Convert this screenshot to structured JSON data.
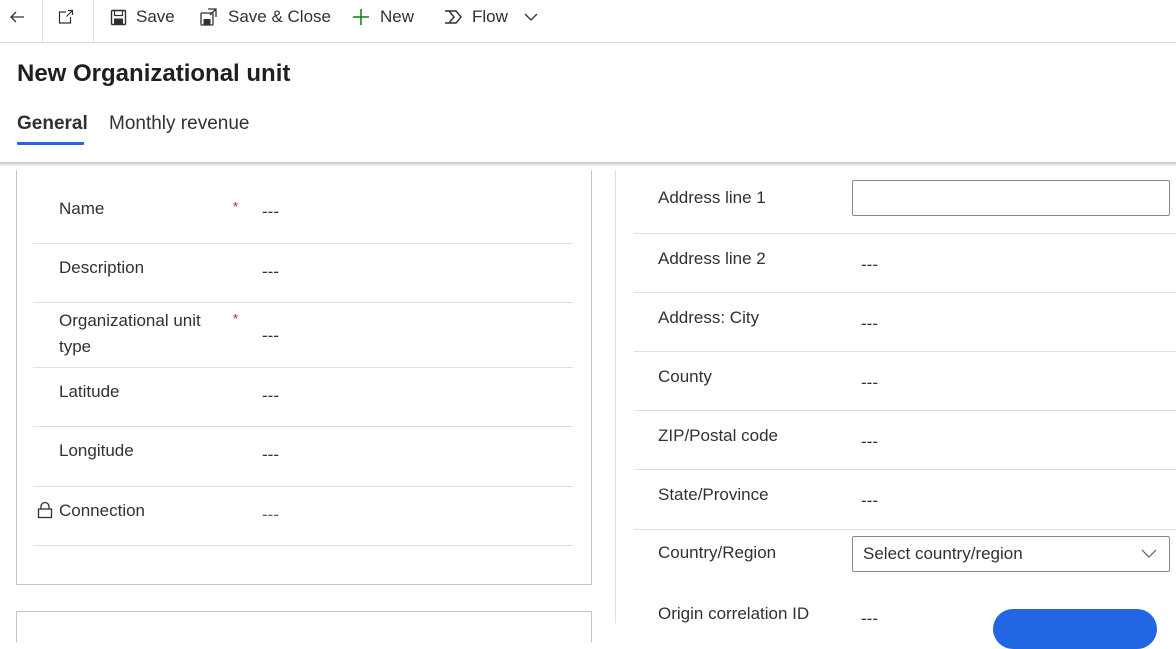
{
  "toolbar": {
    "back_icon": "back-arrow-icon",
    "popout_icon": "open-in-new-window-icon",
    "save_label": "Save",
    "save_close_label": "Save & Close",
    "new_label": "New",
    "flow_label": "Flow"
  },
  "page": {
    "title": "New Organizational unit",
    "tabs": [
      {
        "label": "General",
        "active": true
      },
      {
        "label": "Monthly revenue",
        "active": false
      }
    ]
  },
  "general": {
    "fields": [
      {
        "label": "Name",
        "value": "---",
        "required": true,
        "required_mark": "*"
      },
      {
        "label": "Description",
        "value": "---",
        "required": false
      },
      {
        "label_line1": "Organizational unit",
        "label_line2": "type",
        "value": "---",
        "required": true,
        "required_mark": "*"
      },
      {
        "label": "Latitude",
        "value": "---",
        "required": false
      },
      {
        "label": "Longitude",
        "value": "---",
        "required": false
      },
      {
        "label": "Connection",
        "value": "---",
        "locked": true
      }
    ]
  },
  "address": {
    "fields": [
      {
        "label": "Address line 1",
        "value": ""
      },
      {
        "label": "Address line 2",
        "value": "---"
      },
      {
        "label": "Address: City",
        "value": "---"
      },
      {
        "label": "County",
        "value": "---"
      },
      {
        "label": "ZIP/Postal code",
        "value": "---"
      },
      {
        "label": "State/Province",
        "value": "---"
      },
      {
        "label": "Country/Region",
        "placeholder": "Select country/region"
      },
      {
        "label": "Origin correlation ID",
        "value": "---"
      }
    ]
  },
  "colors": {
    "accent": "#2266e3",
    "required": "#a4262c",
    "new_icon": "#107c10"
  }
}
